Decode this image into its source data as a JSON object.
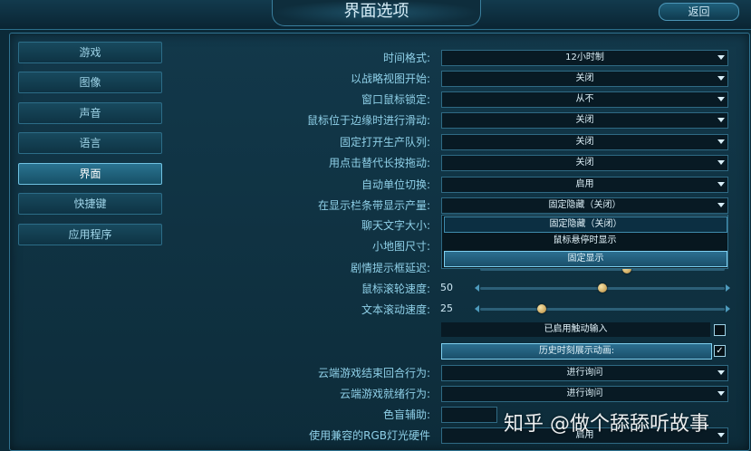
{
  "header": {
    "title": "界面选项",
    "back_label": "返回"
  },
  "sidebar": {
    "items": [
      {
        "label": "游戏"
      },
      {
        "label": "图像"
      },
      {
        "label": "声音"
      },
      {
        "label": "语言"
      },
      {
        "label": "界面",
        "active": true
      },
      {
        "label": "快捷键"
      },
      {
        "label": "应用程序"
      }
    ]
  },
  "settings": {
    "time_format": {
      "label": "时间格式:",
      "value": "12小时制"
    },
    "strategic_view": {
      "label": "以战略视图开始:",
      "value": "关闭"
    },
    "cursor_lock": {
      "label": "窗口鼠标锁定:",
      "value": "从不"
    },
    "edge_scroll": {
      "label": "鼠标位于边缘时进行滑动:",
      "value": "关闭"
    },
    "production_queue": {
      "label": "固定打开生产队列:",
      "value": "关闭"
    },
    "click_drag": {
      "label": "用点击替代长按拖动:",
      "value": "关闭"
    },
    "auto_cycle": {
      "label": "自动单位切换:",
      "value": "启用"
    },
    "ribbon_yields": {
      "label": "在显示栏条带显示产量:",
      "value": "固定隐藏（关闭）",
      "options": [
        "固定隐藏（关闭）",
        "鼠标悬停时显示",
        "固定显示"
      ]
    },
    "chat_text_size": {
      "label": "聊天文字大小:"
    },
    "minimap_size": {
      "label": "小地图尺寸:"
    },
    "tooltip_delay": {
      "label": "剧情提示框延迟:",
      "value": ""
    },
    "scroll_speed": {
      "label": "鼠标滚轮速度:",
      "value": "50",
      "level": 0.5
    },
    "text_scroll": {
      "label": "文本滚动速度:",
      "value": "25",
      "level": 0.25
    },
    "touch_input": {
      "label": "已启用触动输入",
      "checked": false
    },
    "historic_moments": {
      "label": "历史时刻展示动画:",
      "checked": true,
      "check_glyph": "✓"
    },
    "cloud_turn_end": {
      "label": "云端游戏结束回合行为:",
      "value": "进行询问"
    },
    "cloud_ready": {
      "label": "云端游戏就绪行为:",
      "value": "进行询问"
    },
    "colorblind": {
      "label": "色盲辅助:"
    },
    "rgb_hardware": {
      "label": "使用兼容的RGB灯光硬件",
      "value": "启用"
    }
  },
  "watermark": "知乎 @做个舔舔听故事",
  "colors": {
    "accent": "#6fc2e2",
    "background": "#0b2a38",
    "label": "#8fd0e8"
  }
}
